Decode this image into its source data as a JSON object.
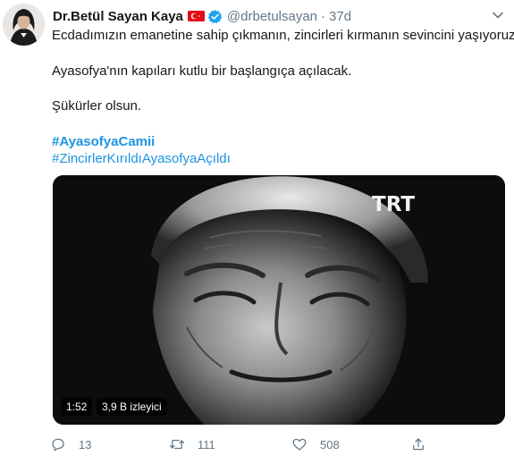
{
  "tweet": {
    "author_name": "Dr.Betül Sayan Kaya",
    "handle": "@drbetulsayan",
    "separator": "·",
    "time": "37d",
    "lines": [
      "Ecdadımızın emanetine sahip çıkmanın, zincirleri kırmanın sevincini yaşıyoruz.",
      "Ayasofya'nın kapıları kutlu bir başlangıça açılacak.",
      "Şükürler olsun."
    ],
    "hashtags": [
      "#AyasofyaCamii",
      "#ZincirlerKırıldıAyasofyaAçıldı"
    ],
    "link_color": "#1b95e0",
    "icons": {
      "flag": "turkey-flag-icon",
      "verified": "verified-badge-icon",
      "menu": "chevron-down-icon"
    }
  },
  "video": {
    "watermark": "TRT",
    "duration": "1:52",
    "views": "3,9 B izleyici"
  },
  "actions": {
    "reply_count": "13",
    "retweet_count": "111",
    "like_count": "508",
    "icons": [
      "reply-icon",
      "retweet-icon",
      "like-icon",
      "share-icon"
    ]
  }
}
